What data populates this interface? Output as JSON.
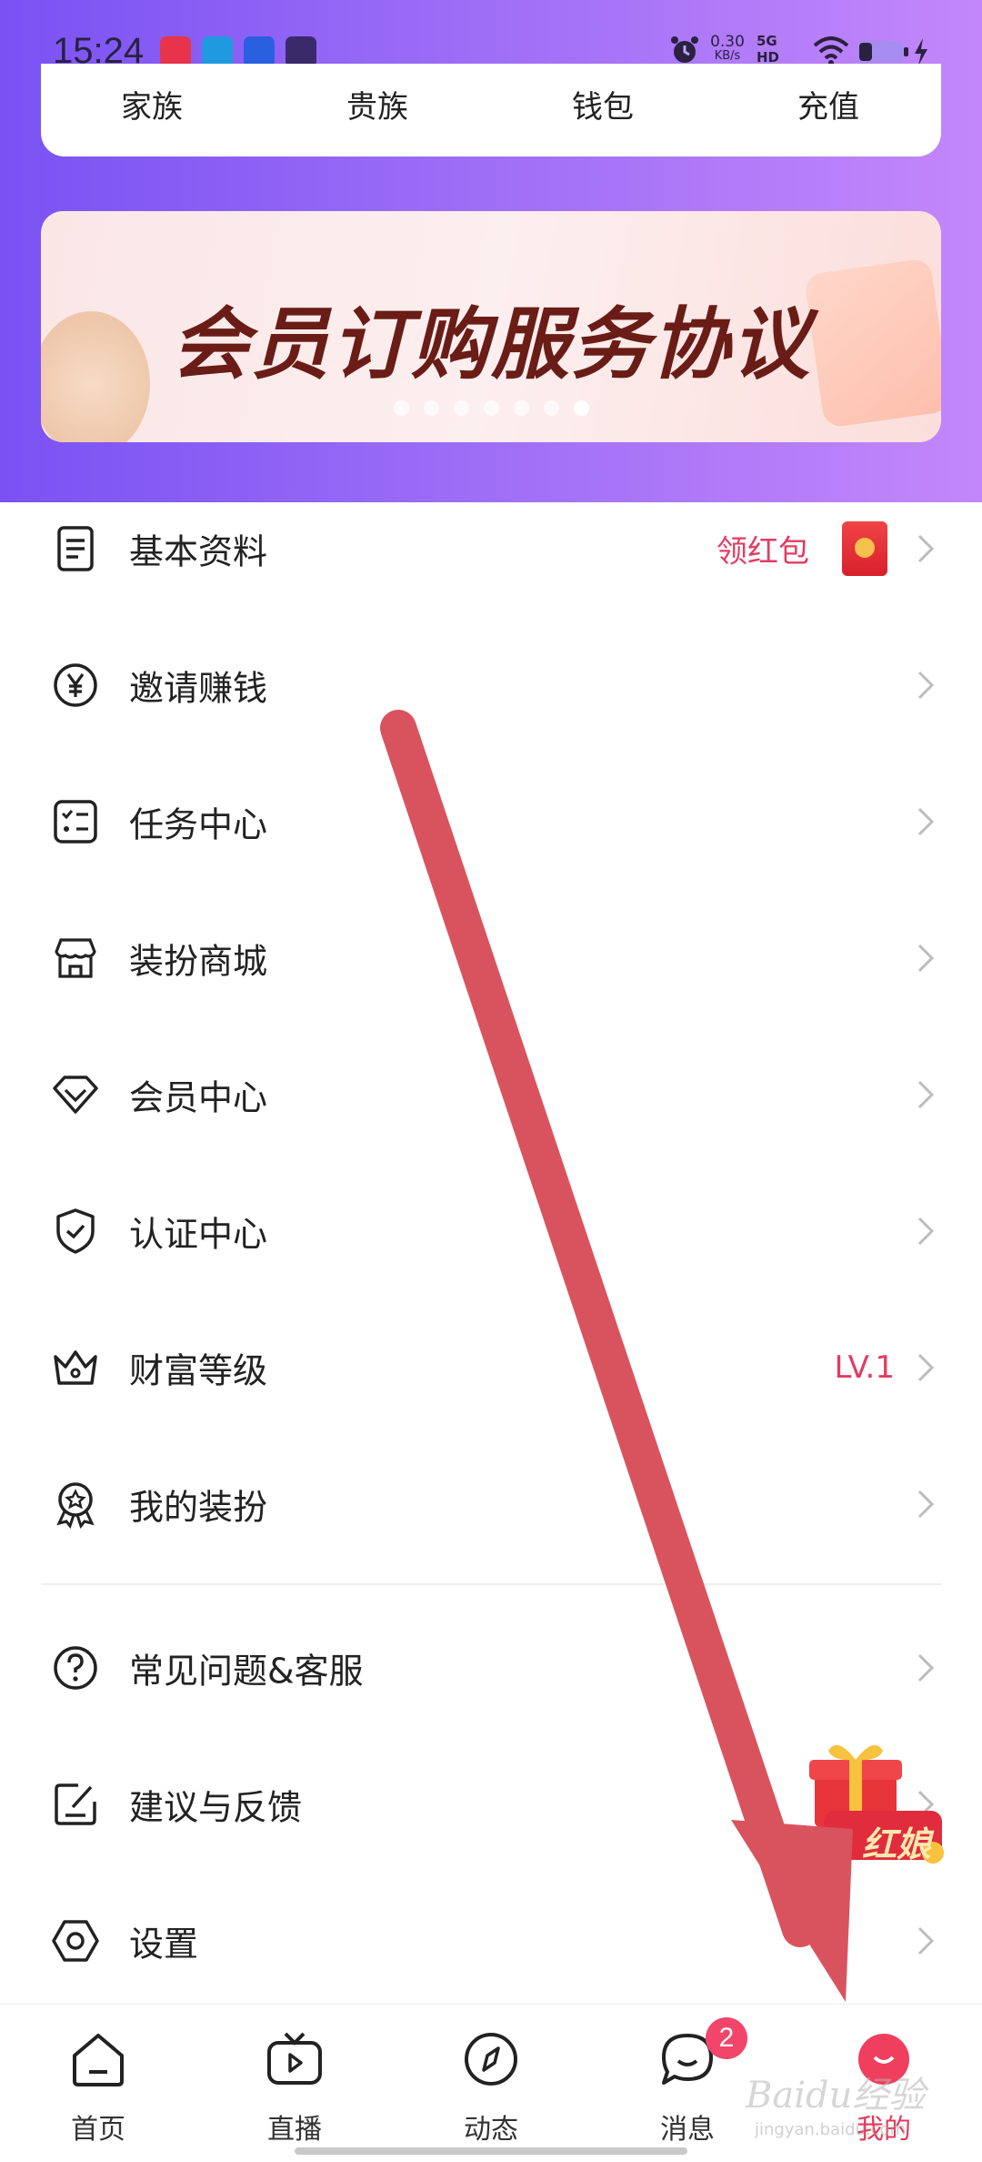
{
  "status_bar": {
    "time": "15:24",
    "net_speed_value": "0.30",
    "net_speed_unit": "KB/s",
    "network_type": "5G HD"
  },
  "top_tabs": [
    "家族",
    "贵族",
    "钱包",
    "充值"
  ],
  "banner": {
    "text": "会员订购服务协议",
    "dot_count": 7,
    "active_dot": 6
  },
  "menu": {
    "items": [
      {
        "label": "基本资料",
        "icon": "profile-doc-icon",
        "right_text": "领红包",
        "has_red_packet": true
      },
      {
        "label": "邀请赚钱",
        "icon": "yen-coin-icon",
        "right_text": ""
      },
      {
        "label": "任务中心",
        "icon": "task-list-icon",
        "right_text": ""
      },
      {
        "label": "装扮商城",
        "icon": "store-icon",
        "right_text": ""
      },
      {
        "label": "会员中心",
        "icon": "diamond-icon",
        "right_text": ""
      },
      {
        "label": "认证中心",
        "icon": "shield-check-icon",
        "right_text": ""
      },
      {
        "label": "财富等级",
        "icon": "crown-icon",
        "right_text": "LV.1"
      },
      {
        "label": "我的装扮",
        "icon": "badge-medal-icon",
        "right_text": ""
      }
    ],
    "items2": [
      {
        "label": "常见问题&客服",
        "icon": "help-circle-icon"
      },
      {
        "label": "建议与反馈",
        "icon": "feedback-edit-icon"
      },
      {
        "label": "设置",
        "icon": "settings-hex-icon"
      }
    ]
  },
  "promo": {
    "text": "红娘"
  },
  "bottom_nav": [
    {
      "label": "首页",
      "icon": "home-icon"
    },
    {
      "label": "直播",
      "icon": "live-tv-icon"
    },
    {
      "label": "动态",
      "icon": "compass-icon"
    },
    {
      "label": "消息",
      "icon": "chat-bubble-icon",
      "badge": "2"
    },
    {
      "label": "我的",
      "icon": "me-icon",
      "active": true
    }
  ],
  "watermark": {
    "main": "Baidu经验",
    "sub": "jingyan.baidu.com"
  },
  "colors": {
    "header_gradient_start": "#7a52f4",
    "header_gradient_end": "#c387fb",
    "accent_red": "#e33a5c",
    "banner_text": "#6a1c16",
    "annotation_arrow": "#d9535e"
  }
}
